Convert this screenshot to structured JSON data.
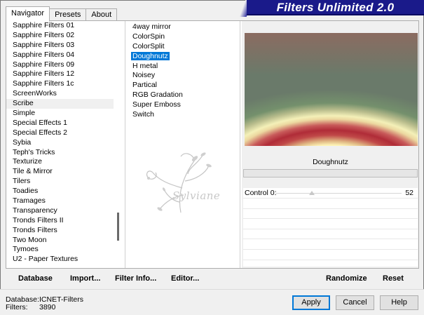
{
  "tabs": [
    {
      "label": "Navigator",
      "active": true
    },
    {
      "label": "Presets",
      "active": false
    },
    {
      "label": "About",
      "active": false
    }
  ],
  "banner_title": "Filters Unlimited 2.0",
  "categories": [
    "Sapphire Filters 01",
    "Sapphire Filters 02",
    "Sapphire Filters 03",
    "Sapphire Filters 04",
    "Sapphire Filters 09",
    "Sapphire Filters 12",
    "Sapphire Filters 1c",
    "ScreenWorks",
    "Scribe",
    "Simple",
    "Special Effects 1",
    "Special Effects 2",
    "Sybia",
    "Teph's Tricks",
    "Texturize",
    "Tile & Mirror",
    "Tilers",
    "Toadies",
    "Tramages",
    "Transparency",
    "Tronds Filters II",
    "Tronds Filters",
    "Two Moon",
    "Tymoes",
    "U2 - Paper Textures"
  ],
  "selected_category": "Scribe",
  "filters": [
    "4way mirror",
    "ColorSpin",
    "ColorSplit",
    "Doughnutz",
    "H metal",
    "Noisey",
    "Partical",
    "RGB Gradation",
    "Super Emboss",
    "Switch"
  ],
  "selected_filter": "Doughnutz",
  "watermark_text": "Sylviane",
  "preview": {
    "filter_name": "Doughnutz"
  },
  "controls": [
    {
      "label": "Control 0:",
      "value": "52"
    }
  ],
  "actions": {
    "database": "Database",
    "import": "Import...",
    "filter_info": "Filter Info...",
    "editor": "Editor...",
    "randomize": "Randomize",
    "reset": "Reset"
  },
  "info": {
    "database_label": "Database:",
    "database_value": "ICNET-Filters",
    "filters_label": "Filters:",
    "filters_value": "3890"
  },
  "buttons": {
    "apply": "Apply",
    "cancel": "Cancel",
    "help": "Help"
  }
}
